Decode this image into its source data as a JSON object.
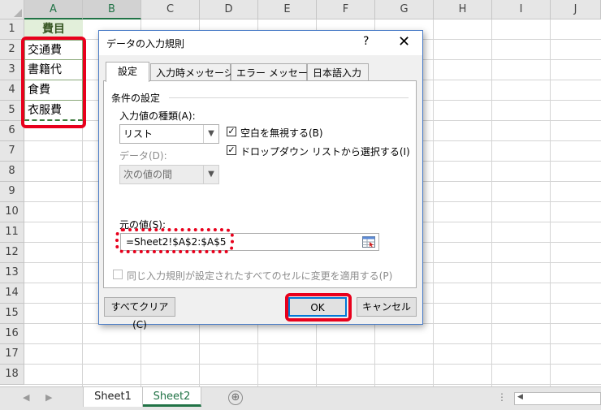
{
  "spreadsheet": {
    "columns": [
      "A",
      "B",
      "C",
      "D",
      "E",
      "F",
      "G",
      "H",
      "I",
      "J"
    ],
    "rows": [
      "1",
      "2",
      "3",
      "4",
      "5",
      "6",
      "7",
      "8",
      "9",
      "10",
      "11",
      "12",
      "13",
      "14",
      "15",
      "16",
      "17",
      "18"
    ],
    "header_cell": "費目",
    "items": [
      "交通費",
      "書籍代",
      "食費",
      "衣服費"
    ],
    "sheet_tabs": [
      "Sheet1",
      "Sheet2"
    ],
    "add_sheet": "⊕"
  },
  "dialog": {
    "title": "データの入力規則",
    "help": "?",
    "close": "✕",
    "tabs": [
      "設定",
      "入力時メッセージ",
      "エラー メッセージ",
      "日本語入力"
    ],
    "section": "条件の設定",
    "allow_label": "入力値の種類(A):",
    "allow_value": "リスト",
    "ignore_blank": "空白を無視する(B)",
    "in_cell_dropdown": "ドロップダウン リストから選択する(I)",
    "data_label": "データ(D):",
    "data_value": "次の値の間",
    "source_label": "元の値(S):",
    "source_value": "=Sheet2!$A$2:$A$5",
    "apply_all": "同じ入力規則が設定されたすべてのセルに変更を適用する(P)",
    "clear_all": "すべてクリア(C)",
    "ok": "OK",
    "cancel": "キャンセル"
  }
}
